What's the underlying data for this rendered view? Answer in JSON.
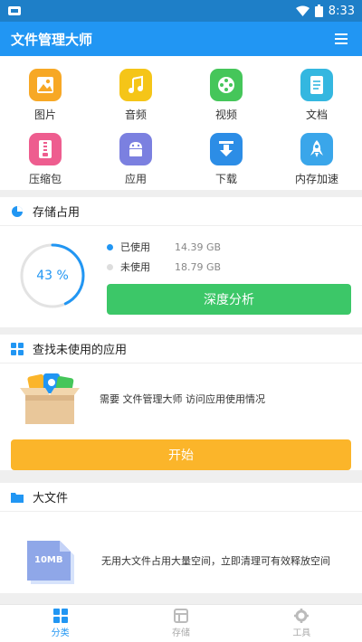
{
  "status": {
    "time": "8:33"
  },
  "app": {
    "title": "文件管理大师"
  },
  "categories": [
    {
      "label": "图片",
      "icon": "image-icon",
      "color": "#f7a825"
    },
    {
      "label": "音频",
      "icon": "music-icon",
      "color": "#f5c518"
    },
    {
      "label": "视频",
      "icon": "film-icon",
      "color": "#45c65a"
    },
    {
      "label": "文档",
      "icon": "document-icon",
      "color": "#34b7e0"
    },
    {
      "label": "压缩包",
      "icon": "zip-icon",
      "color": "#ee5d8f"
    },
    {
      "label": "应用",
      "icon": "android-icon",
      "color": "#7b80e0"
    },
    {
      "label": "下载",
      "icon": "download-icon",
      "color": "#2c8de6"
    },
    {
      "label": "内存加速",
      "icon": "rocket-icon",
      "color": "#3aa6ea"
    }
  ],
  "storage": {
    "title": "存储占用",
    "percent_label": "43 %",
    "percent": 0.43,
    "used_label": "已使用",
    "used_value": "14.39 GB",
    "free_label": "未使用",
    "free_value": "18.79 GB",
    "button": "深度分析"
  },
  "unused_apps": {
    "title": "查找未使用的应用",
    "message": "需要 文件管理大师 访问应用使用情况",
    "button": "开始"
  },
  "large_files": {
    "title": "大文件",
    "badge": "10MB",
    "message": "无用大文件占用大量空间，立即清理可有效释放空间"
  },
  "nav": [
    {
      "label": "分类",
      "icon": "grid-icon",
      "active": true
    },
    {
      "label": "存储",
      "icon": "storage-icon",
      "active": false
    },
    {
      "label": "工具",
      "icon": "gear-icon",
      "active": false
    }
  ],
  "colors": {
    "primary": "#2196f3",
    "green": "#3cc768",
    "orange": "#fbb52a"
  }
}
